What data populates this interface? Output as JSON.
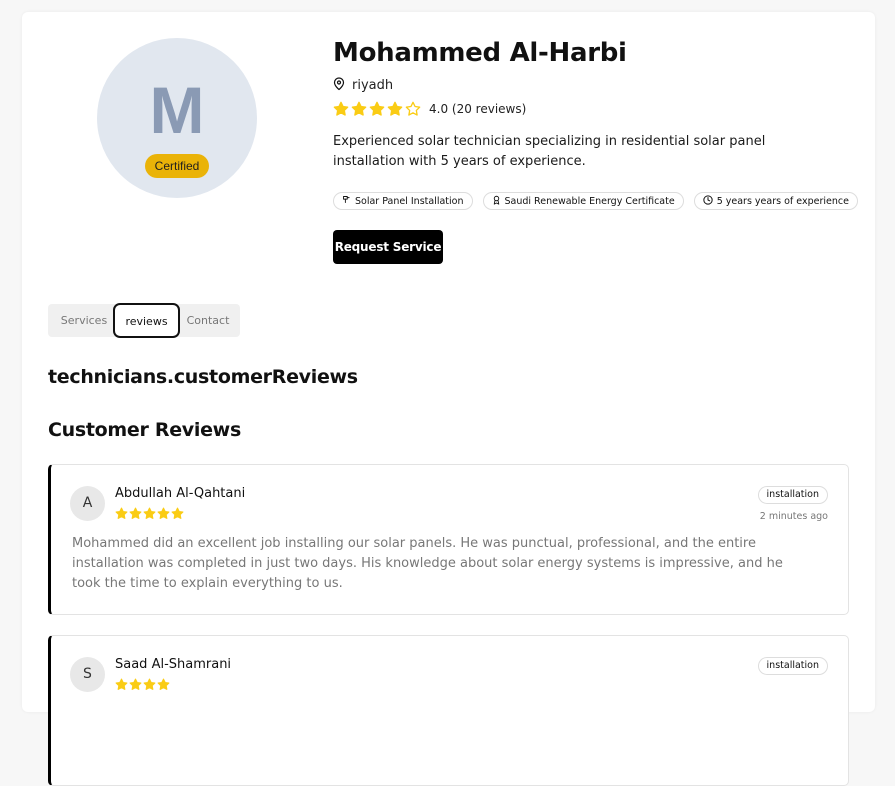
{
  "profile": {
    "avatar_letter": "M",
    "certified_label": "Certified",
    "name": "Mohammed Al-Harbi",
    "location": "riyadh",
    "rating": 4.0,
    "rating_text": "4.0 (20 reviews)",
    "description": "Experienced solar technician specializing in residential solar panel installation with 5 years of experience.",
    "badges": [
      {
        "icon": "wrench-icon",
        "label": "Solar Panel Installation"
      },
      {
        "icon": "award-icon",
        "label": "Saudi Renewable Energy Certificate"
      },
      {
        "icon": "clock-icon",
        "label": "5 years years of experience"
      }
    ],
    "request_button": "Request Service"
  },
  "tabs": [
    {
      "label": "Services",
      "active": false
    },
    {
      "label": "reviews",
      "active": true
    },
    {
      "label": "Contact",
      "active": false
    }
  ],
  "section_key_title": "technicians.customerReviews",
  "section_title": "Customer Reviews",
  "reviews": [
    {
      "initial": "A",
      "name": "Abdullah Al-Qahtani",
      "rating": 5,
      "category": "installation",
      "time": "2 minutes ago",
      "text": "Mohammed did an excellent job installing our solar panels. He was punctual, professional, and the entire installation was completed in just two days. His knowledge about solar energy systems is impressive, and he took the time to explain everything to us."
    },
    {
      "initial": "S",
      "name": "Saad Al-Shamrani",
      "rating": 4,
      "category": "installation",
      "time": "",
      "text": ""
    }
  ],
  "colors": {
    "star": "#facc15",
    "certified": "#eab308",
    "avatar_bg": "#e1e7ef",
    "avatar_letter": "#8a9ab4",
    "primary_button": "#000000"
  }
}
